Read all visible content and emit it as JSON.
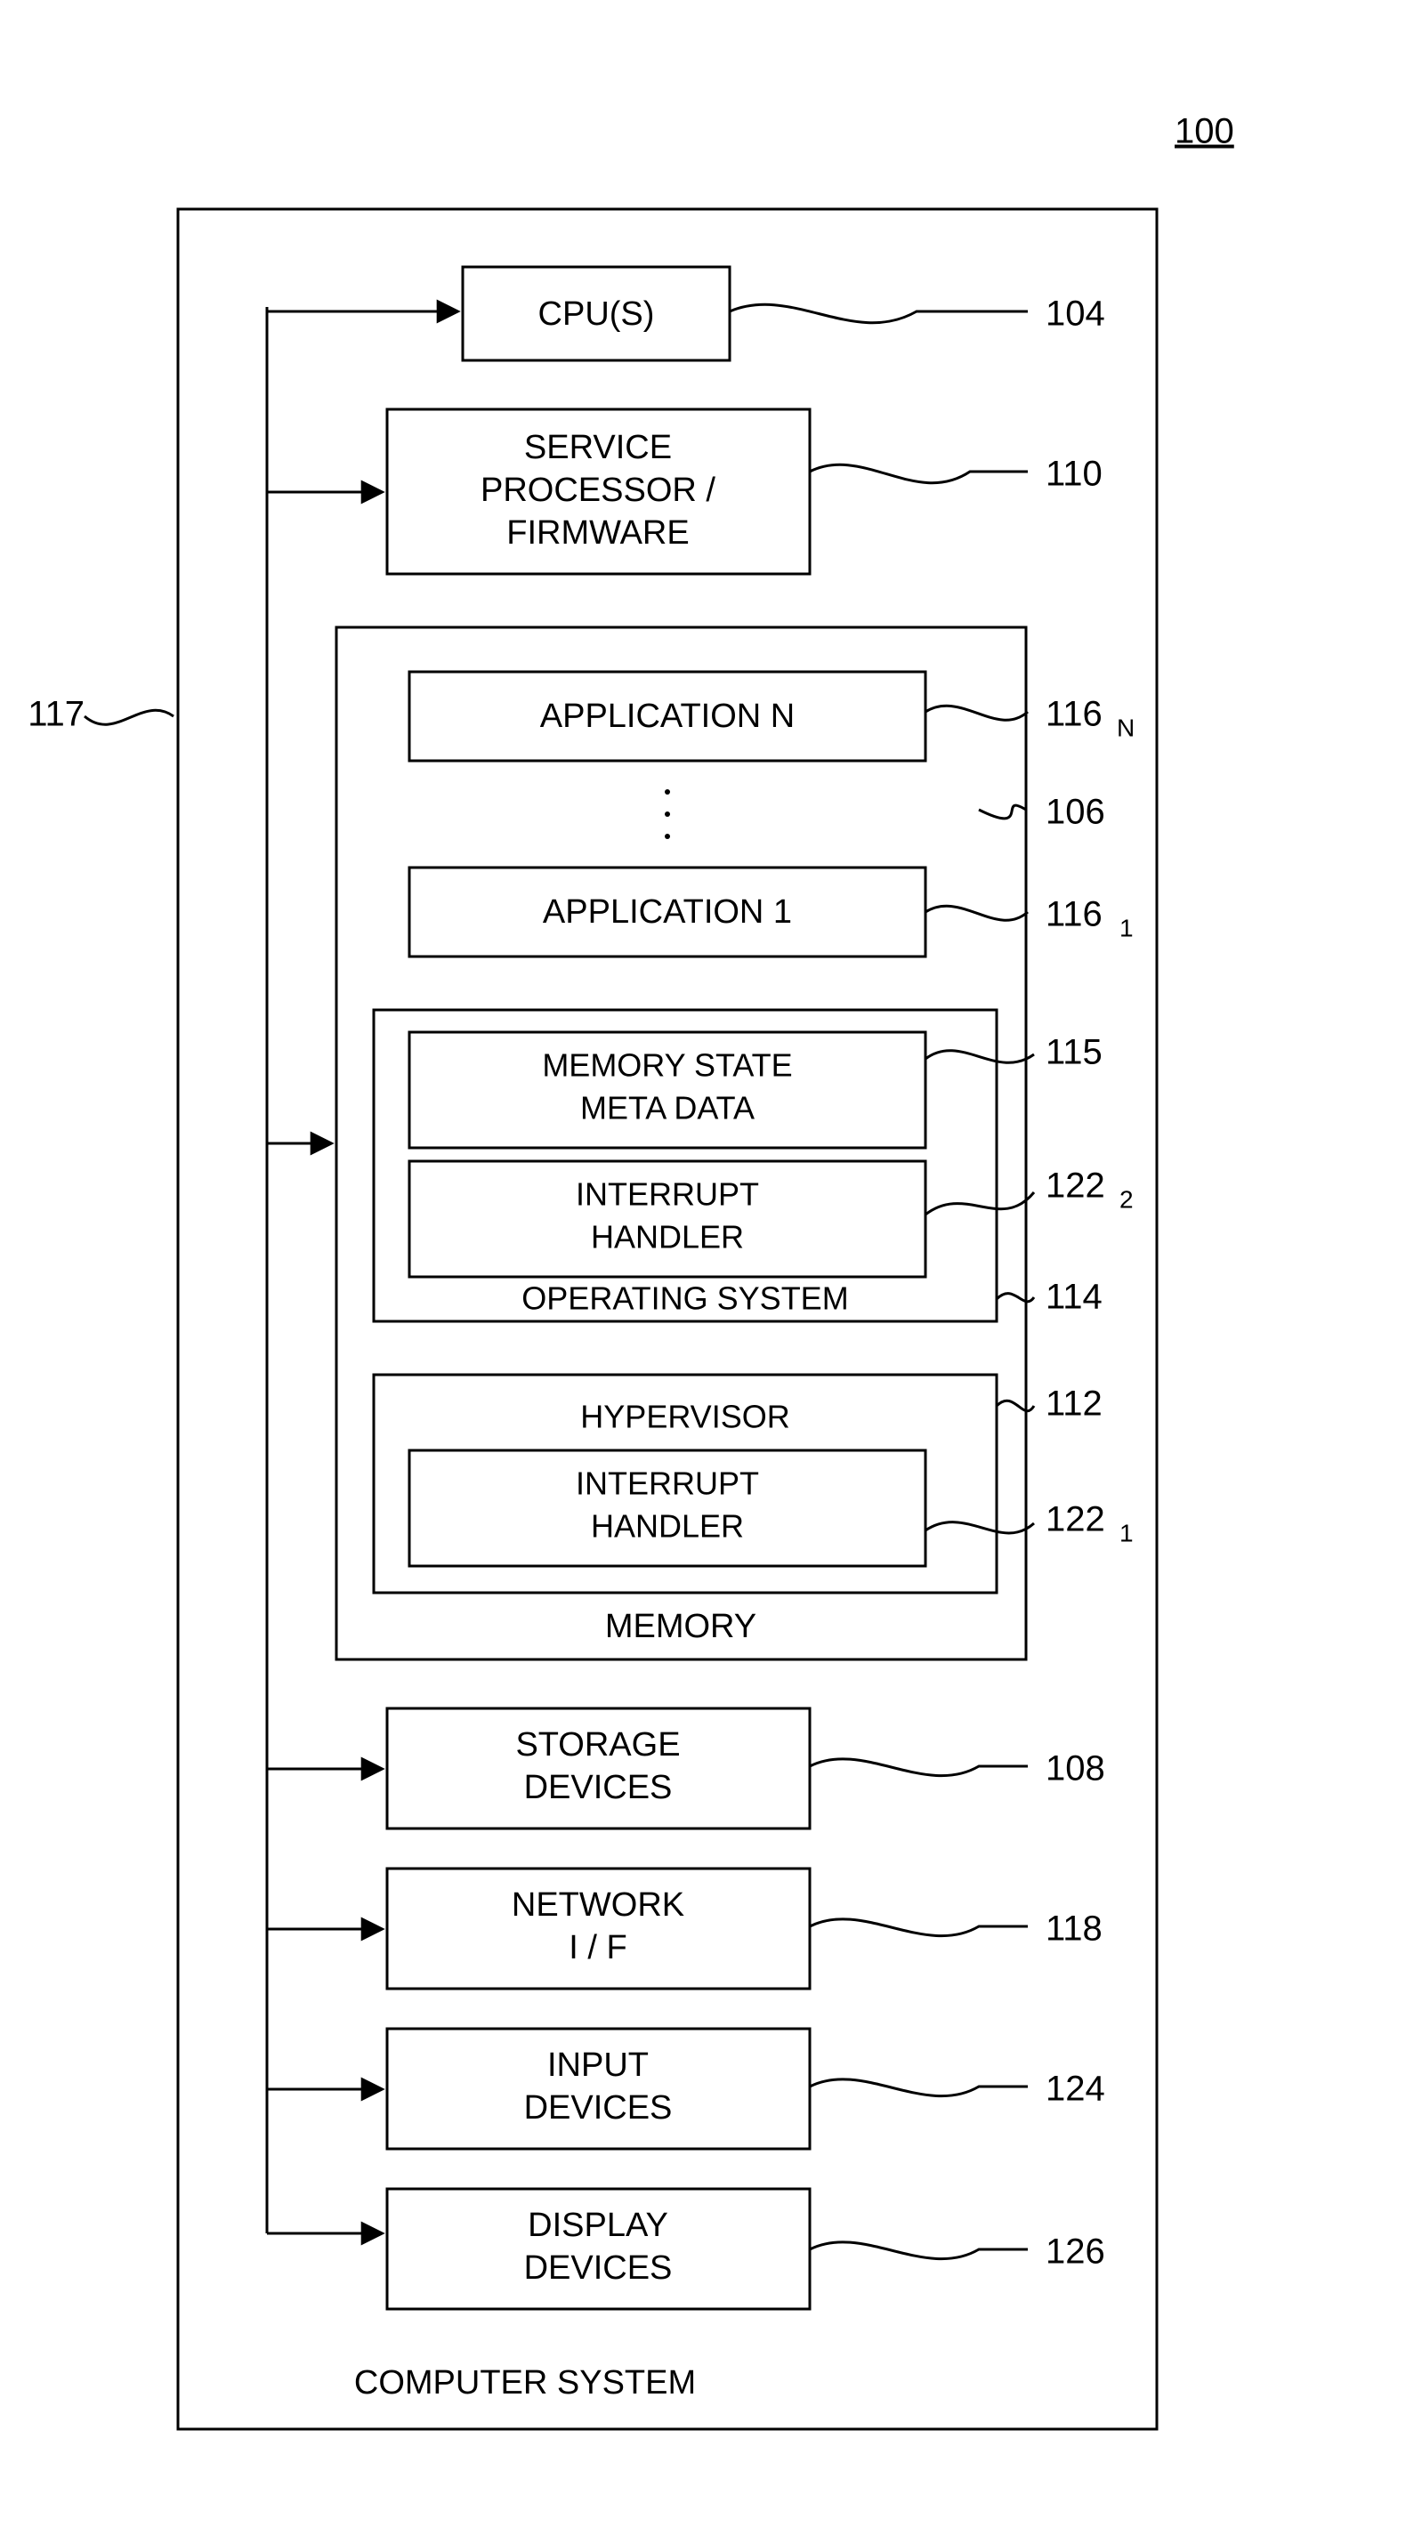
{
  "figure_ref": "100",
  "container": "COMPUTER SYSTEM",
  "blocks": {
    "cpu": "CPU(S)",
    "svc1": "SERVICE",
    "svc2": "PROCESSOR /",
    "svc3": "FIRMWARE",
    "appN": "APPLICATION  N",
    "app1": "APPLICATION  1",
    "msm1": "MEMORY STATE",
    "msm2": "META DATA",
    "ih": "INTERRUPT",
    "ih2": "HANDLER",
    "os": "OPERATING SYSTEM",
    "hv": "HYPERVISOR",
    "mem": "MEMORY",
    "stg1": "STORAGE",
    "stg2": "DEVICES",
    "net1": "NETWORK",
    "net2": "I / F",
    "in1": "INPUT",
    "in2": "DEVICES",
    "dsp1": "DISPLAY",
    "dsp2": "DEVICES"
  },
  "refs": {
    "r100": "100",
    "r104": "104",
    "r110": "110",
    "r116N": "116",
    "r116Ns": "N",
    "r106": "106",
    "r1161": "116",
    "r1161s": "1",
    "r115": "115",
    "r1222": "122",
    "r1222s": "2",
    "r114": "114",
    "r112": "112",
    "r1221": "122",
    "r1221s": "1",
    "r108": "108",
    "r118": "118",
    "r124": "124",
    "r126": "126",
    "r117": "117"
  }
}
